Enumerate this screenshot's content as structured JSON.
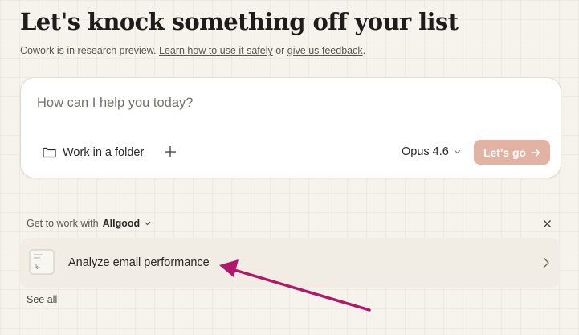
{
  "header": {
    "title": "Let's knock something off your list",
    "subtitle_prefix": "Cowork is in research preview. ",
    "learn_link": "Learn how to use it safely",
    "subtitle_or": " or ",
    "feedback_link": "give us feedback",
    "subtitle_suffix": "."
  },
  "composer": {
    "placeholder": "How can I help you today?",
    "folder_label": "Work in a folder",
    "model_label": "Opus 4.6",
    "go_label": "Let's go",
    "go_color": "#e2b3a3"
  },
  "suggestions": {
    "prefix": "Get to work with",
    "brand": "Allgood",
    "items": [
      {
        "label": "Analyze email performance",
        "icon": "document-icon"
      }
    ],
    "see_all": "See all"
  },
  "annotation": {
    "arrow_color": "#b0186a"
  }
}
